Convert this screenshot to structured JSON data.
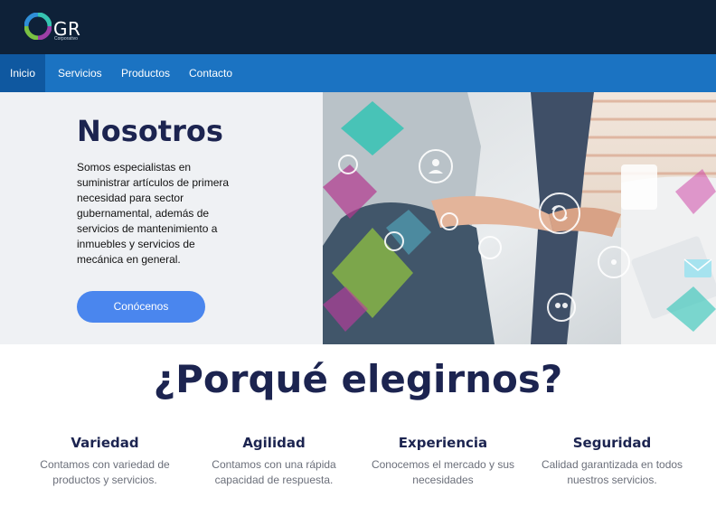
{
  "brand": {
    "logo_text": "GR",
    "logo_sub": "Corporativo"
  },
  "nav": {
    "items": [
      {
        "label": "Inicio",
        "active": true
      },
      {
        "label": "Servicios",
        "active": false
      },
      {
        "label": "Productos",
        "active": false
      },
      {
        "label": "Contacto",
        "active": false
      }
    ]
  },
  "hero": {
    "title": "Nosotros",
    "text": "Somos especialistas en suministrar artículos de primera necesidad para sector gubernamental, además de servicios de mantenimiento a inmuebles y servicios de mecánica en general.",
    "button_label": "Conócenos"
  },
  "why": {
    "title": "¿Porqué elegirnos?",
    "features": [
      {
        "title": "Variedad",
        "desc": "Contamos con variedad de productos y servicios."
      },
      {
        "title": "Agilidad",
        "desc": "Contamos con una rápida capacidad de respuesta."
      },
      {
        "title": "Experiencia",
        "desc": "Conocemos el mercado y sus necesidades"
      },
      {
        "title": "Seguridad",
        "desc": "Calidad garantizada en todos nuestros servicios."
      }
    ]
  },
  "colors": {
    "header_bg": "#0e2138",
    "nav_bg": "#1b73c2",
    "nav_active": "#0f58a0",
    "heading": "#1c2450",
    "button": "#4a86ee"
  }
}
